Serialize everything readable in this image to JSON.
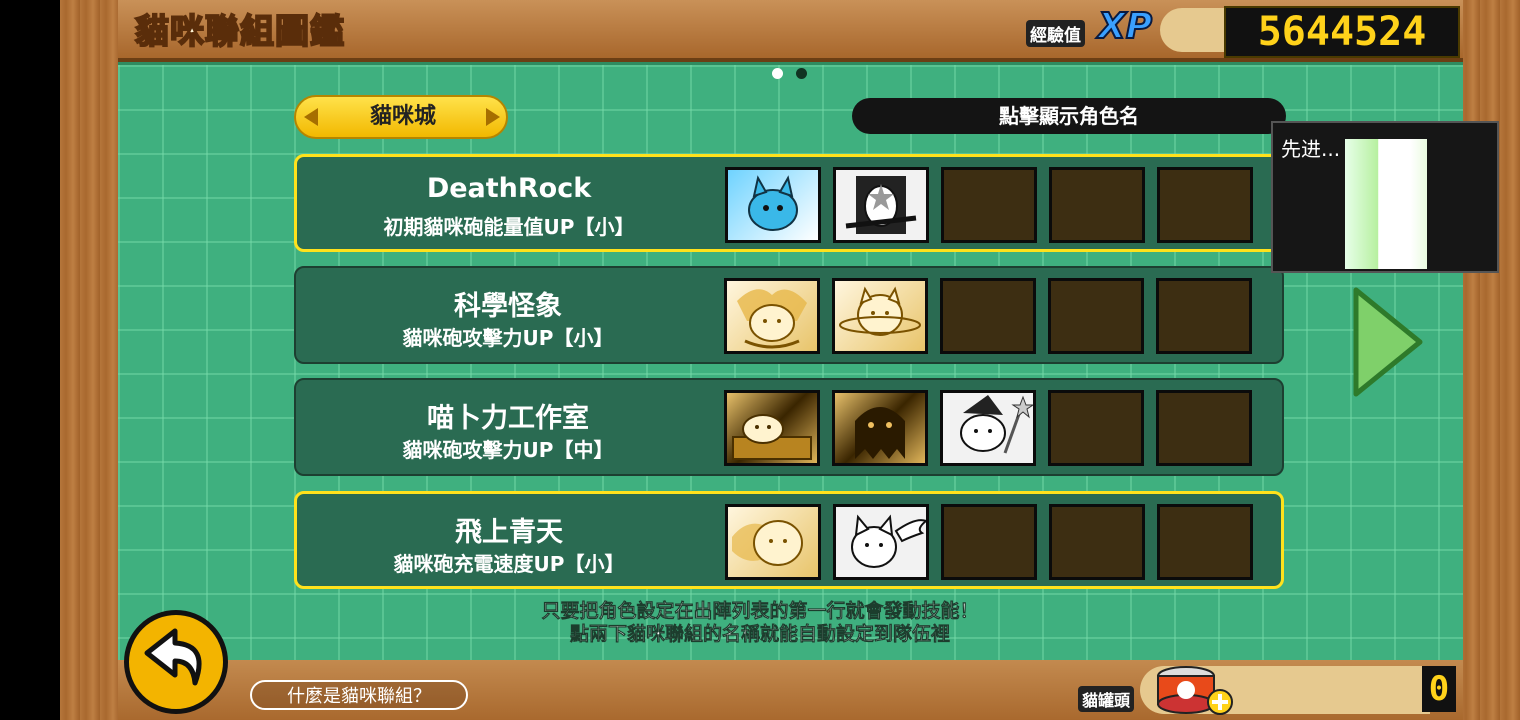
{
  "header": {
    "title": "貓咪聯組圖鑑",
    "xp_label": "經驗值",
    "xp_badge": "XP",
    "xp_value": "5644524"
  },
  "tab": {
    "label": "貓咪城"
  },
  "show_names_button": "點擊顯示角色名",
  "combos": [
    {
      "name": "DeathRock",
      "effect": "初期貓咪砲能量值UP【小】",
      "selected": true
    },
    {
      "name": "科學怪象",
      "effect": "貓咪砲攻擊力UP【小】",
      "selected": false
    },
    {
      "name": "喵卜力工作室",
      "effect": "貓咪砲攻擊力UP【中】",
      "selected": false
    },
    {
      "name": "飛上青天",
      "effect": "貓咪砲充電速度UP【小】",
      "selected": true
    }
  ],
  "hint": {
    "line1": "只要把角色設定在出陣列表的第一行就會發動技能！",
    "line2": "點兩下貓咪聯組的名稱就能自動設定到隊伍裡"
  },
  "footer": {
    "help_button": "什麼是貓咪聯組？",
    "cat_food_label": "貓罐頭",
    "cat_food_value": "0"
  },
  "overlay": {
    "label": "先进..."
  },
  "colors": {
    "board": "#3fb07f",
    "highlight": "#ffe21c",
    "counter": "#ffd21a"
  }
}
